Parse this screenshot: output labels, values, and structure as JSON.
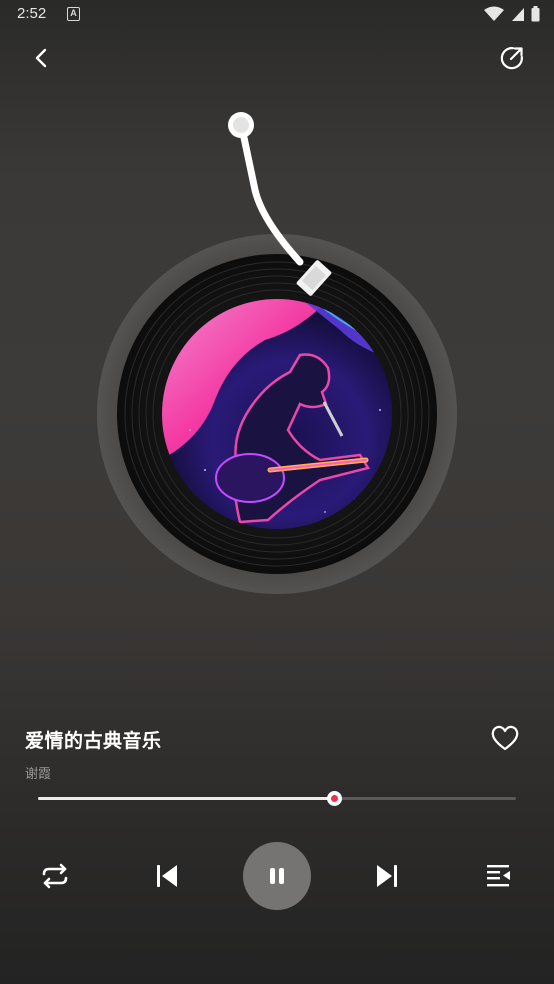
{
  "status_bar": {
    "time": "2:52",
    "notification_icon_letter": "A",
    "icons": [
      "wifi-icon",
      "cell-signal-icon",
      "battery-icon"
    ]
  },
  "header": {
    "back_icon": "chevron-left-icon",
    "share_icon": "share-external-icon"
  },
  "player": {
    "song_title": "爱情的古典音乐",
    "artist": "谢霞",
    "progress": 0.62,
    "favorite_icon": "heart-outline-icon",
    "accent_color": "#e8354b"
  },
  "controls": {
    "loop_icon": "repeat-icon",
    "prev_icon": "skip-previous-icon",
    "play_pause_icon": "pause-icon",
    "next_icon": "skip-next-icon",
    "playlist_icon": "playlist-icon"
  }
}
